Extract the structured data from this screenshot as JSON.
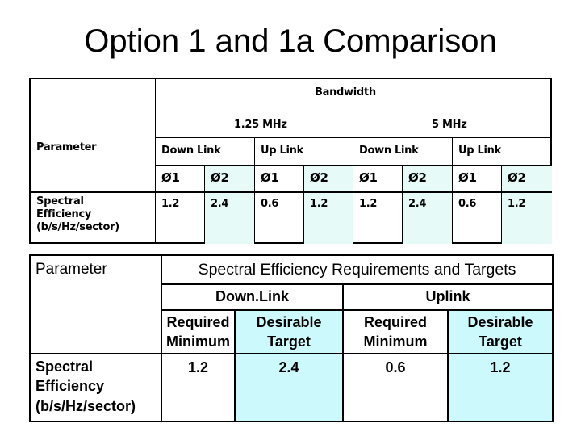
{
  "slide": {
    "title": "Option 1 and 1a Comparison"
  },
  "table_option1": {
    "parameter_header": "Parameter",
    "bandwidth_header": "Bandwidth",
    "bands": [
      {
        "label": "1.25 MHz",
        "links": [
          {
            "label": "Down Link",
            "phases": [
              "Ø1",
              "Ø2"
            ],
            "values": [
              "1.2",
              "2.4"
            ]
          },
          {
            "label": "Up Link",
            "phases": [
              "Ø1",
              "Ø2"
            ],
            "values": [
              "0.6",
              "1.2"
            ]
          }
        ]
      },
      {
        "label": "5 MHz",
        "links": [
          {
            "label": "Down Link",
            "phases": [
              "Ø1",
              "Ø2"
            ],
            "values": [
              "1.2",
              "2.4"
            ]
          },
          {
            "label": "Up Link",
            "phases": [
              "Ø1",
              "Ø2"
            ],
            "values": [
              "0.6",
              "1.2"
            ]
          }
        ]
      }
    ],
    "row_label": [
      "Spectral",
      "Efficiency",
      "(b/s/Hz/sector)"
    ],
    "highlight_color": "#e6fbf7"
  },
  "table_option1a": {
    "parameter_header": "Parameter",
    "group_header": "Spectral Efficiency Requirements and Targets",
    "links": [
      {
        "label": "Down.Link",
        "columns": [
          {
            "label": [
              "Required",
              "Minimum"
            ],
            "value": "1.2"
          },
          {
            "label": [
              "Desirable",
              "Target"
            ],
            "value": "2.4"
          }
        ]
      },
      {
        "label": "Uplink",
        "columns": [
          {
            "label": [
              "Required",
              "Minimum"
            ],
            "value": "0.6"
          },
          {
            "label": [
              "Desirable",
              "Target"
            ],
            "value": "1.2"
          }
        ]
      }
    ],
    "row_label": [
      "Spectral",
      "Efficiency",
      "(b/s/Hz/sector)"
    ],
    "highlight_color": "#ccf9fb"
  }
}
